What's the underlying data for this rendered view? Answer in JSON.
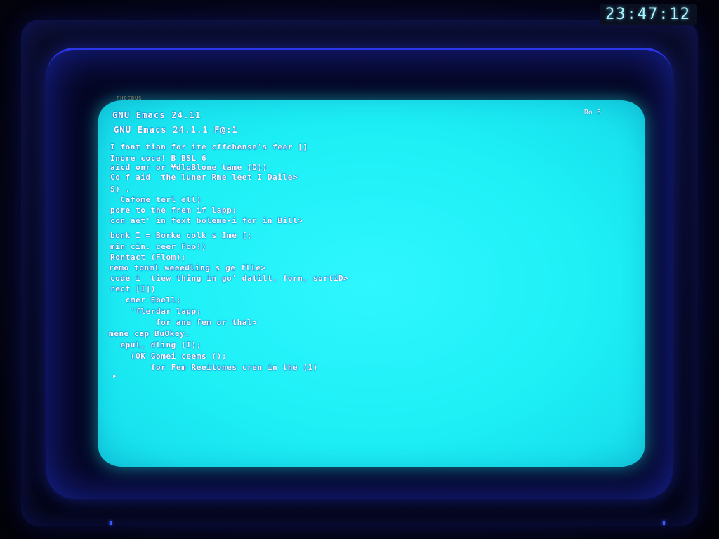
{
  "clock": "23:47:12",
  "screen": {
    "brand_label": "PHOEBUS",
    "corner_text": "Ro 6",
    "title_lines": [
      "GNU Emacs 24.11",
      "GNU Emacs 24.1.1 F@:1"
    ],
    "code_lines": [
      "I font tian for ite cffchense's feer []",
      "Inore coce! B BSL 6",
      "aicd onr or ¥dloBlone tame (D))",
      "Co f aid  the luner Rme leet I Daile>",
      "S) .",
      "  Cafome terl ell)",
      "pore to the frem if lapp;",
      "con aet' in fext boleme-i for in Bill>",
      "bonk I = Borke colk s Ime [;",
      "min cin. ceer Foo!)",
      "Rontact (Flom);",
      "remo tonml weeedling s ge flle>",
      "code i  tiew thing in go' datilt, forn, sortiD>",
      "rect [I])",
      "   cmer Ebell;",
      "    'flerdar lapp;",
      "         for ane fem or thal>",
      "mene cap BuOkey.",
      "  epul, dling (I);",
      "    (OK Gomei ceems ();",
      "        for Fem Reeitones cren in the (1)"
    ],
    "cursor": "▸"
  }
}
